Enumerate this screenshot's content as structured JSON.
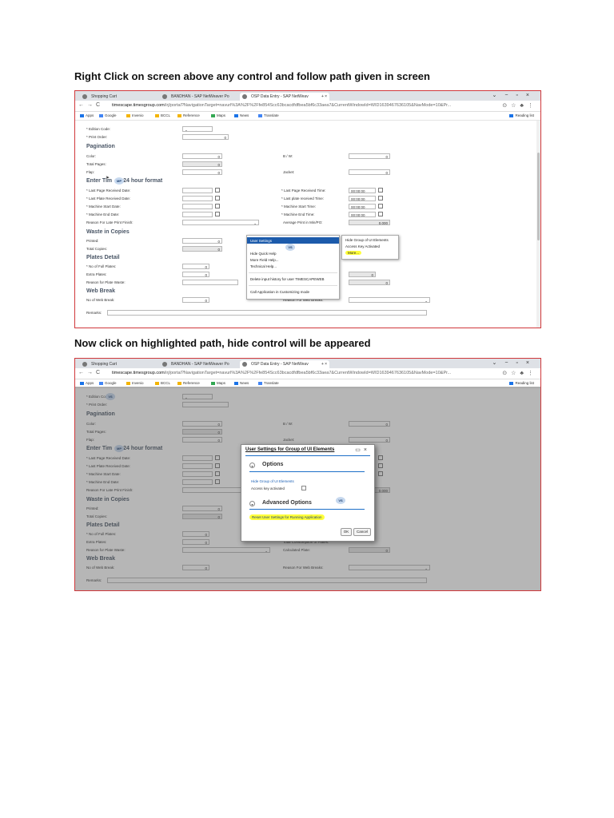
{
  "steps": [
    {
      "heading": "Right Click on screen above any control and follow path given in screen"
    },
    {
      "heading": "Now click on highlighted path, hide control will be appeared"
    }
  ],
  "browser": {
    "tabs": [
      {
        "label": "Shopping Cart"
      },
      {
        "label": "BANDHAN - SAP NetWeaver Po"
      },
      {
        "label": "OSP Data Entry - SAP NetWeav"
      }
    ],
    "url_host": "timescape.timesgroup.com",
    "url_path": "/irj/portal?NavigationTarget=navurl%3A%2F%2Ffe854Scc63bcacdfdfbea5bf6c33aea7&CurrentWindowId=WID1639467636105&NavMode=10&Pr...",
    "bookmarks": [
      "Apps",
      "Google",
      "Invenio",
      "BCCL",
      "Reference",
      "Maps",
      "News",
      "Translate"
    ],
    "reading_list": "Reading list"
  },
  "form": {
    "edition_code": "* Edition Code:",
    "print_order": "* Print Order:",
    "print_order_value": "0",
    "pagination": "Pagination",
    "color": "Color:",
    "bw": "B / W:",
    "total_pages": "Total Pages:",
    "flap": "Flap:",
    "jacket": "Jacket:",
    "zero": "0",
    "enter_time_left": "Enter Tim",
    "enter_time_right": "24 hour format",
    "last_page_received_date": "* Last Page Received Date:",
    "last_plate_received_date": "* Last Plate Received Date:",
    "machine_start_date": "* Machine Start Date:",
    "machine_end_date": "* Machine End Date:",
    "reason_late_print": "Reason For Late Print Finish:",
    "last_page_received_time": "* Last Page Received Time:",
    "last_plate_received_time": "* Last plate received Time:",
    "machine_start_time": "* Machine Start Time:",
    "machine_end_time": "* Machine End Time:",
    "time_value": "00:00:00",
    "average_print": "Average Print in Min/PO:",
    "average_value": "0.000",
    "waste_copies": "Waste in Copies",
    "printed": "Printed:",
    "total_copies": "Total Copies:",
    "plates_detail": "Plates Detail",
    "no_full_plates": "* No of Full Plates:",
    "extra_plates": "Extra Plates:",
    "reason_plate_waste": "Reason for Plate Waste:",
    "total_consumption": "Total Consumption of Plates:",
    "calculated_plate": "Calculated Plate:",
    "web_break": "Web Break",
    "no_web_break": "No of Web Break:",
    "reason_web_break": "Reason For Web Breaks:",
    "remarks": "Remarks:",
    "badge_mp": "MP",
    "badge_vs": "VS"
  },
  "context_menu": {
    "user_settings": "User Settings",
    "hide_quick_help": "Hide Quick Help",
    "more_field_help": "More Field Help...",
    "technical_help": "Technical Help...",
    "delete_input_history": "Delete input history for user TIMESCAPEWEB",
    "call_customizing": "Call Application in Customizing mode",
    "submenu": [
      "Hide Group of UI Elements",
      "Access Key Activated",
      "More..."
    ]
  },
  "dialog": {
    "title": "User Settings for Group of UI Elements",
    "options": "Options",
    "hide_group": "Hide Group of UI Elements",
    "access_key": "Access key activated",
    "advanced_options": "Advanced Options",
    "reset": "Reset User Settings for Running Application",
    "ok": "OK",
    "cancel": "Cancel"
  },
  "colors": {
    "frame_border": "#d0383b",
    "highlight": "#ffff3b",
    "menu_selected": "#1c5bab",
    "section_heading": "#4a5666"
  }
}
